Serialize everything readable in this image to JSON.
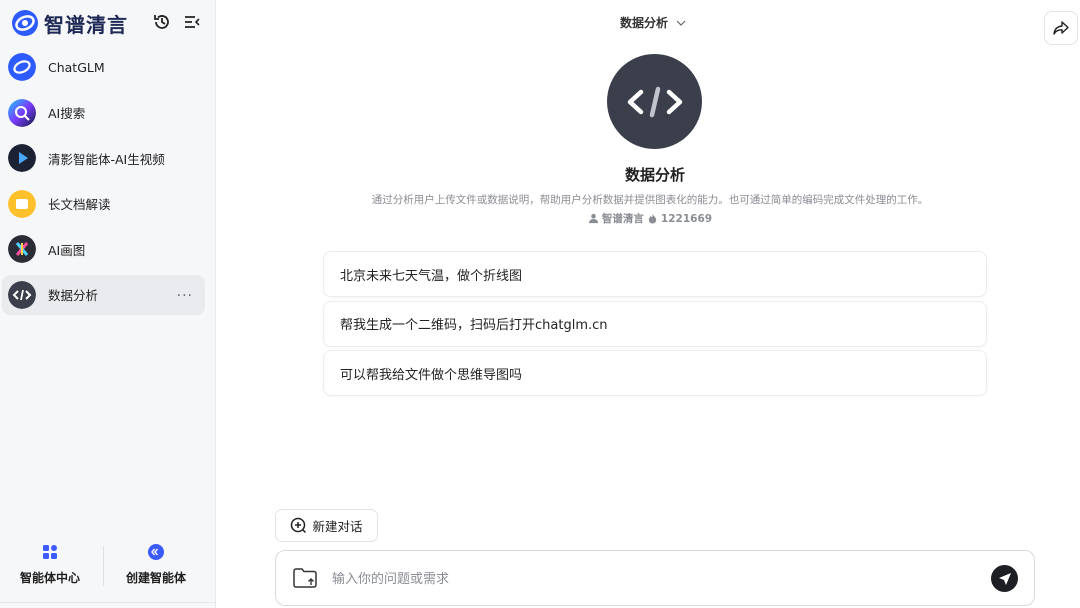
{
  "brand": {
    "name": "智谱清言"
  },
  "sidebar": {
    "agents": [
      {
        "label": "ChatGLM",
        "avatar": "chatglm-logo-icon"
      },
      {
        "label": "AI搜索",
        "avatar": "ai-search-icon"
      },
      {
        "label": "清影智能体-AI生视频",
        "avatar": "video-play-icon"
      },
      {
        "label": "长文档解读",
        "avatar": "folder-doc-icon"
      },
      {
        "label": "AI画图",
        "avatar": "ai-draw-icon"
      },
      {
        "label": "数据分析",
        "avatar": "code-brackets-icon",
        "active": true
      }
    ],
    "more": "···",
    "bottom": {
      "agent_center": "智能体中心",
      "create_agent": "创建智能体"
    }
  },
  "header": {
    "title": "数据分析"
  },
  "agent": {
    "title": "数据分析",
    "description": "通过分析用户上传文件或数据说明，帮助用户分析数据并提供图表化的能力。也可通过简单的编码完成文件处理的工作。",
    "author": "智谱清言",
    "heat": "1221669"
  },
  "suggestions": [
    "北京未来七天气温，做个折线图",
    "帮我生成一个二维码，扫码后打开chatglm.cn",
    "可以帮我给文件做个思维导图吗"
  ],
  "composer": {
    "new_chat": "新建对话",
    "placeholder": "输入你的问题或需求",
    "value": ""
  },
  "colors": {
    "accent": "#3b5bff",
    "dark_avatar": "#3a3f4b",
    "send": "#1d1f24"
  }
}
